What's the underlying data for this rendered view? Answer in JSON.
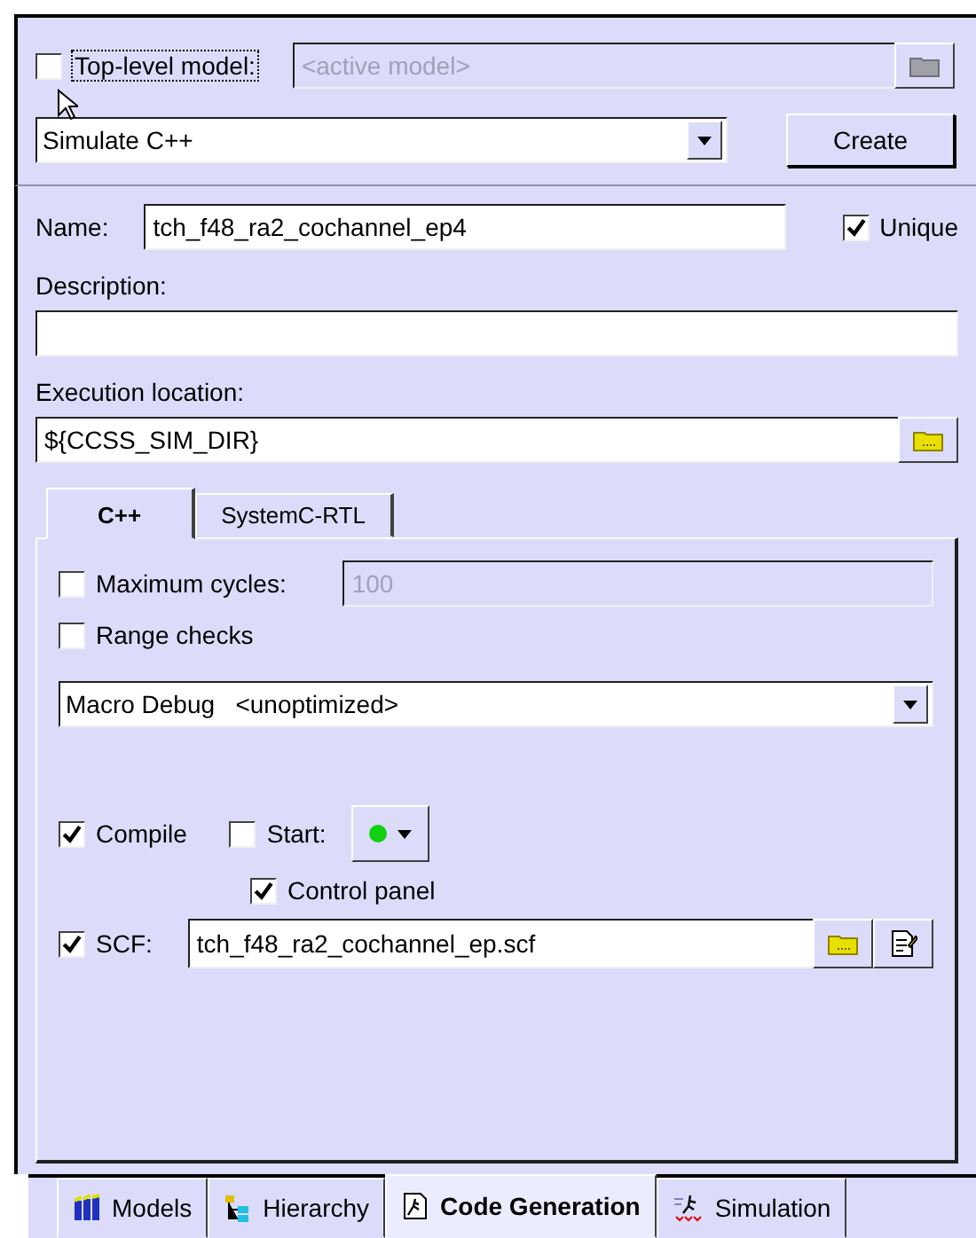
{
  "top_level_model": {
    "label": "Top-level model:",
    "checked": false,
    "placeholder": "<active model>"
  },
  "action": {
    "value": "Simulate C++"
  },
  "create_button": {
    "label": "Create"
  },
  "name": {
    "label": "Name:",
    "value": "tch_f48_ra2_cochannel_ep4"
  },
  "unique": {
    "label": "Unique",
    "checked": true
  },
  "description": {
    "label": "Description:"
  },
  "execution_location": {
    "label": "Execution location:",
    "value": "${CCSS_SIM_DIR}"
  },
  "tabs": [
    {
      "label": "C++",
      "selected": true
    },
    {
      "label": "SystemC-RTL",
      "selected": false
    }
  ],
  "maximum_cycles": {
    "label": "Maximum cycles:",
    "checked": false,
    "value": "100"
  },
  "range_checks": {
    "label": "Range checks",
    "checked": false
  },
  "build_mode": {
    "value": "Macro Debug   <unoptimized>"
  },
  "compile": {
    "label": "Compile",
    "checked": true
  },
  "start": {
    "label": "Start:",
    "checked": false
  },
  "control_panel": {
    "label": "Control panel",
    "checked": true
  },
  "scf": {
    "label": "SCF:",
    "checked": true,
    "value": "tch_f48_ra2_cochannel_ep.scf"
  },
  "bottom_tabs": [
    {
      "label": "Models",
      "kind": "models",
      "selected": false
    },
    {
      "label": "Hierarchy",
      "kind": "hierarchy",
      "selected": false
    },
    {
      "label": "Code Generation",
      "kind": "codegen",
      "selected": true
    },
    {
      "label": "Simulation",
      "kind": "simulation",
      "selected": false
    }
  ]
}
